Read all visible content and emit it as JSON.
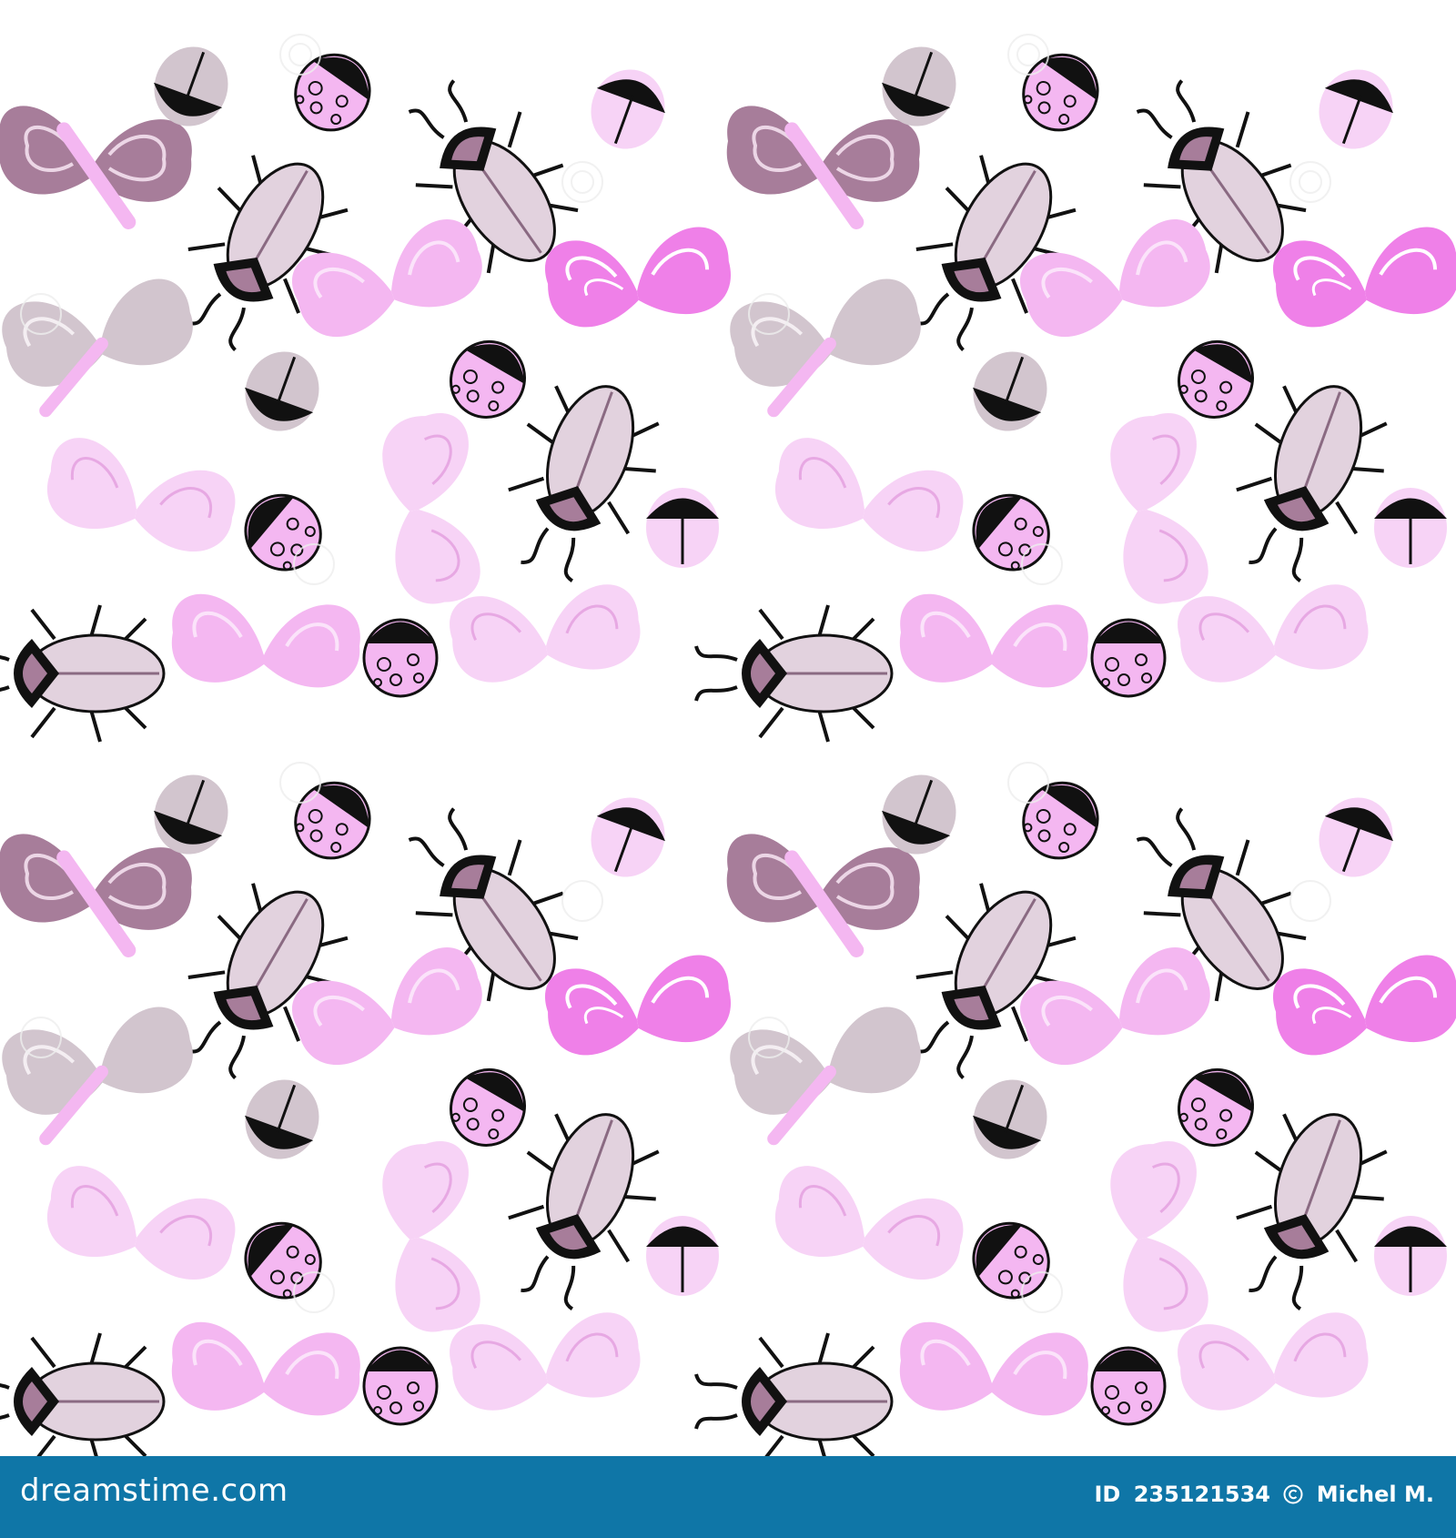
{
  "pattern": {
    "colors": {
      "background": "#ffffff",
      "deep_mauve": "#a77d9a",
      "magenta": "#ef80e8",
      "light_pink": "#f4b7f1",
      "pale_pink": "#f7d3f6",
      "grey_mauve": "#d2c5ce",
      "beetle_shell": "#e2d2de",
      "black": "#111111"
    },
    "elements": [
      "butterfly",
      "beetle",
      "ladybug",
      "small-bug"
    ]
  },
  "footer": {
    "logo": "dreamstime.com",
    "id_label": "ID",
    "id_number": "235121534",
    "copyright_icon": "copyright-icon",
    "author": "Michel M.",
    "color": "#0f76a7"
  }
}
